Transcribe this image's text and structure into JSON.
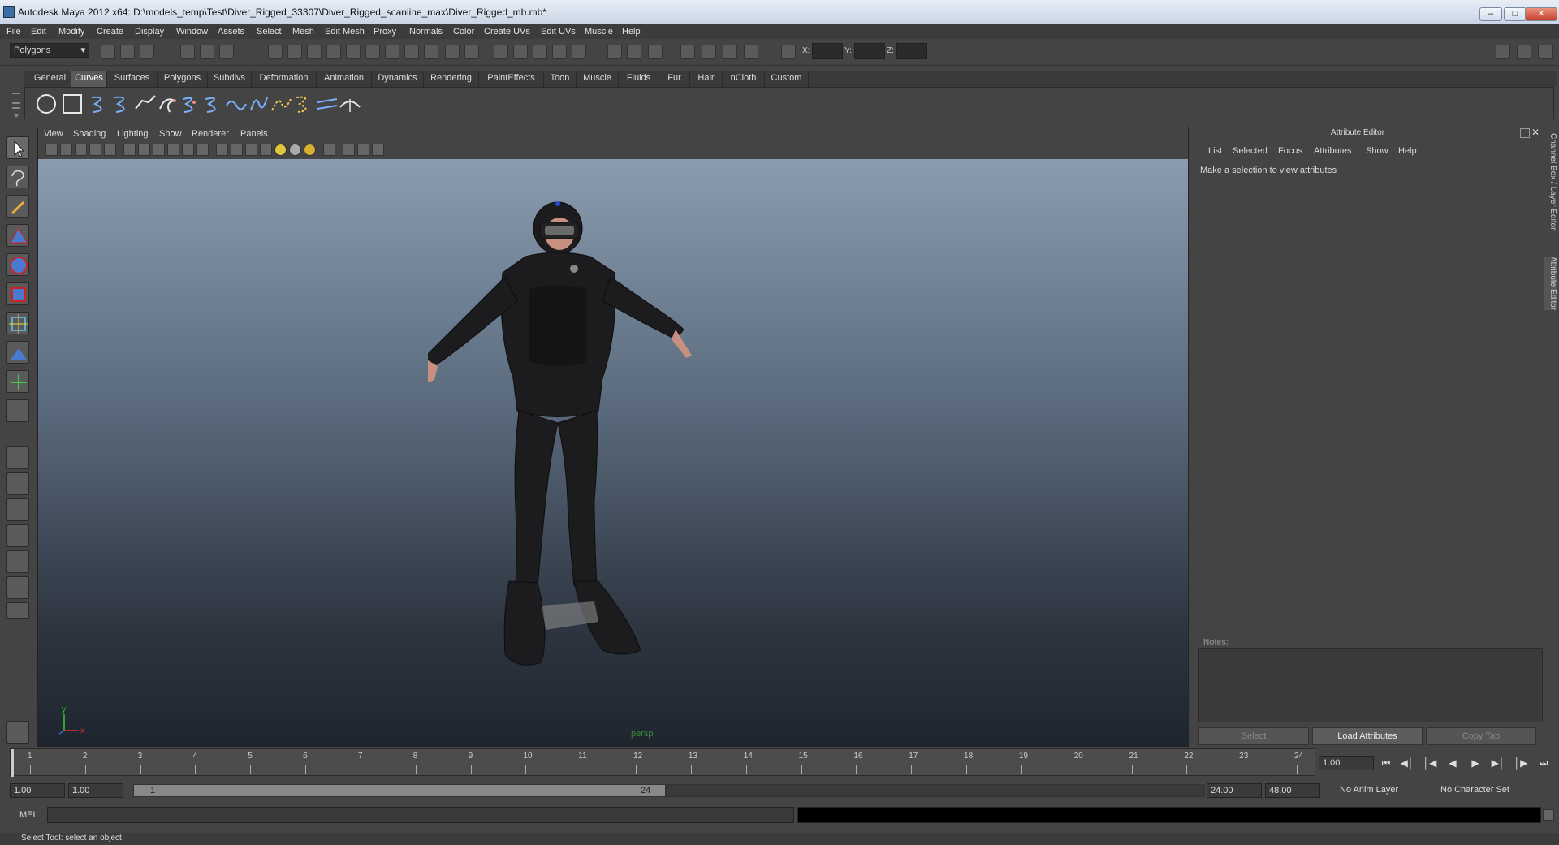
{
  "window": {
    "title": "Autodesk Maya 2012 x64: D:\\models_temp\\Test\\Diver_Rigged_33307\\Diver_Rigged_scanline_max\\Diver_Rigged_mb.mb*",
    "buttons": [
      "minimize",
      "maximize",
      "close"
    ]
  },
  "menubar": [
    "File",
    "Edit",
    "Modify",
    "Create",
    "Display",
    "Window",
    "Assets",
    "Select",
    "Mesh",
    "Edit Mesh",
    "Proxy",
    "Normals",
    "Color",
    "Create UVs",
    "Edit UVs",
    "Muscle",
    "Help"
  ],
  "statusline": {
    "mode": "Polygons",
    "x_label": "X:",
    "y_label": "Y:",
    "z_label": "Z:"
  },
  "shelf": {
    "tabs": [
      "General",
      "Curves",
      "Surfaces",
      "Polygons",
      "Subdivs",
      "Deformation",
      "Animation",
      "Dynamics",
      "Rendering",
      "PaintEffects",
      "Toon",
      "Muscle",
      "Fluids",
      "Fur",
      "Hair",
      "nCloth",
      "Custom"
    ],
    "active_tab": "Curves"
  },
  "panel": {
    "menus": [
      "View",
      "Shading",
      "Lighting",
      "Show",
      "Renderer",
      "Panels"
    ],
    "camera_label": "persp",
    "axis_y": "y",
    "axis_x": "x"
  },
  "attribute_editor": {
    "title": "Attribute Editor",
    "menus": [
      "List",
      "Selected",
      "Focus",
      "Attributes",
      "Show",
      "Help"
    ],
    "message": "Make a selection to view attributes",
    "notes_label": "Notes:",
    "buttons": {
      "select": "Select",
      "load": "Load Attributes",
      "copy": "Copy Tab"
    }
  },
  "side_tabs": {
    "channel_box": "Channel Box / Layer Editor",
    "attribute_editor": "Attribute Editor"
  },
  "timeline": {
    "ticks": [
      "1",
      "2",
      "3",
      "4",
      "5",
      "6",
      "7",
      "8",
      "9",
      "10",
      "11",
      "12",
      "13",
      "14",
      "15",
      "16",
      "17",
      "18",
      "19",
      "20",
      "21",
      "22",
      "23",
      "24"
    ],
    "current_time": "1.00"
  },
  "range": {
    "start_time": "1.00",
    "playback_start": "1.00",
    "range_start_label": "1",
    "range_end_label": "24",
    "playback_end": "24.00",
    "end_time": "48.00",
    "anim_layer": "No Anim Layer",
    "character_set": "No Character Set"
  },
  "cmdline": {
    "label": "MEL"
  },
  "helpline": {
    "text": "Select Tool: select an object"
  }
}
